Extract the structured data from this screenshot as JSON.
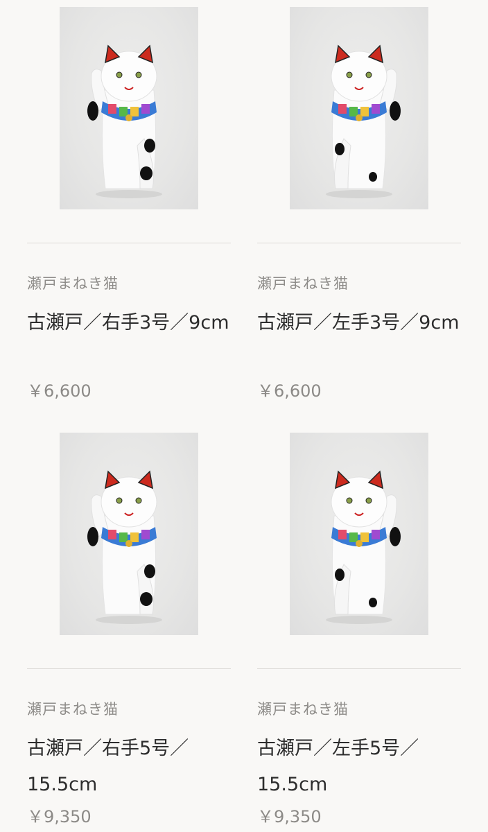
{
  "products": [
    {
      "brand": "瀬戸まねき猫",
      "title": "古瀬戸／右手3号／9cm",
      "price": "￥6,600",
      "raised_paw": "right",
      "image_alt": "maneki-neko-right-paw-3"
    },
    {
      "brand": "瀬戸まねき猫",
      "title": "古瀬戸／左手3号／9cm",
      "price": "￥6,600",
      "raised_paw": "left",
      "image_alt": "maneki-neko-left-paw-3"
    },
    {
      "brand": "瀬戸まねき猫",
      "title": "古瀬戸／右手5号／15.5cm",
      "price": "￥9,350",
      "raised_paw": "right",
      "image_alt": "maneki-neko-right-paw-5"
    },
    {
      "brand": "瀬戸まねき猫",
      "title": "古瀬戸／左手5号／15.5cm",
      "price": "￥9,350",
      "raised_paw": "left",
      "image_alt": "maneki-neko-left-paw-5"
    }
  ],
  "colors": {
    "background": "#f9f8f6",
    "brand_text": "#8e8c89",
    "title_text": "#2d2d2d",
    "price_text": "#8c8a87",
    "divider": "#dcdad6"
  }
}
